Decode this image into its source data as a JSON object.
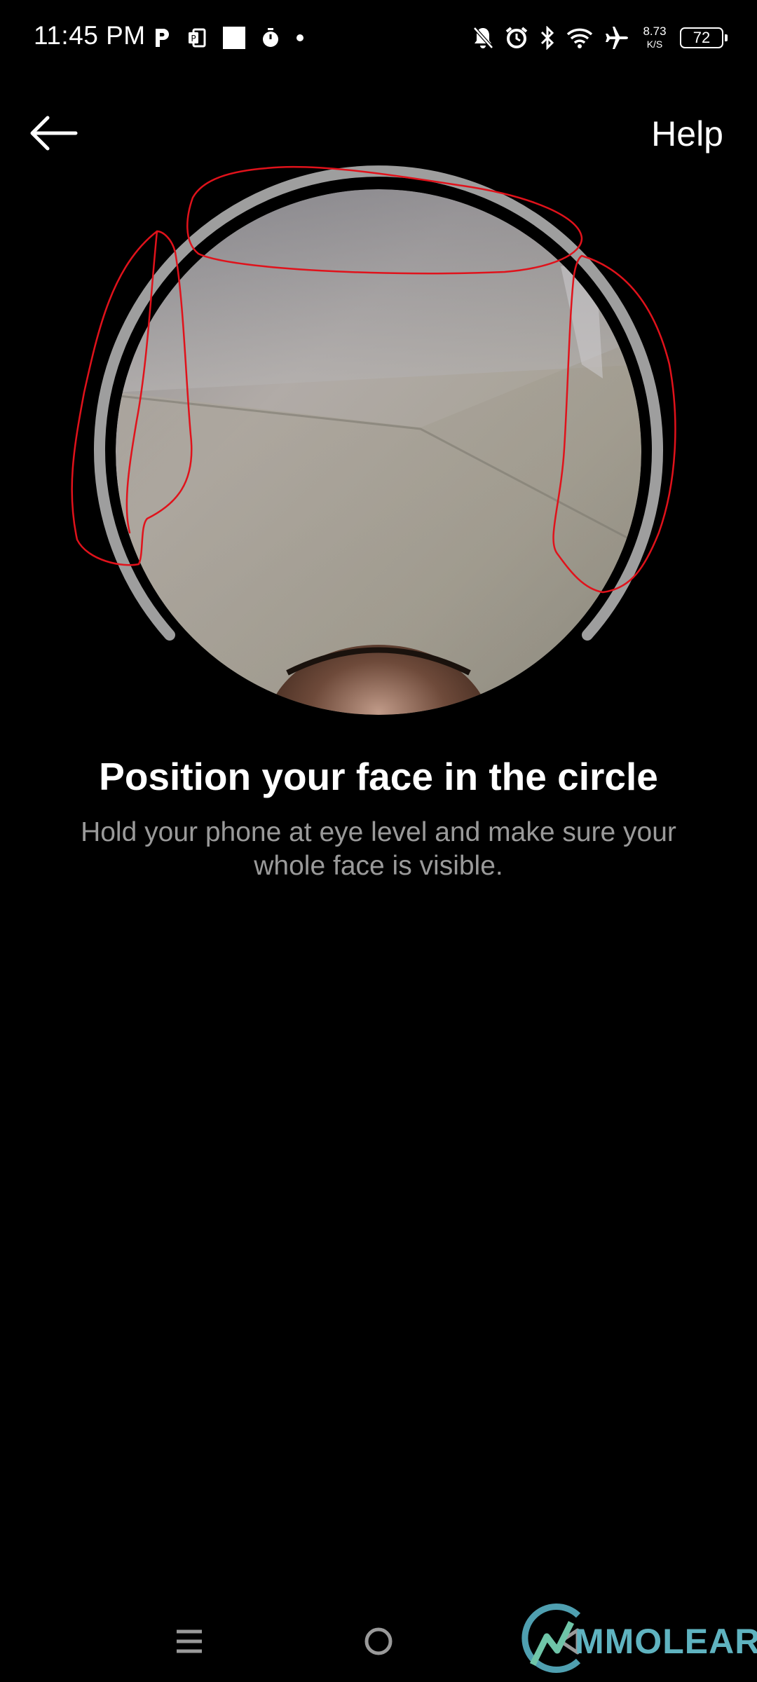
{
  "status_bar": {
    "time": "11:45 PM",
    "left_icons": [
      "parking-app-icon",
      "office-app-icon",
      "white-square-icon",
      "timer-icon",
      "dot-indicator-icon"
    ],
    "right_icons": [
      "bell-muted-icon",
      "alarm-icon",
      "bluetooth-icon",
      "wifi-icon",
      "airplane-icon"
    ],
    "network_speed_value": "8.73",
    "network_speed_unit": "K/S",
    "battery_level": "72"
  },
  "app_bar": {
    "back_icon": "arrow-left-icon",
    "help_label": "Help"
  },
  "camera": {
    "ring_color": "#9e9e9e",
    "annotation_color": "#e0121b"
  },
  "instructions": {
    "title": "Position your face in the circle",
    "body": "Hold your phone at eye level and make sure your whole face is visible."
  },
  "nav_bar": {
    "icons": [
      "menu-lines-icon",
      "home-circle-icon",
      "back-triangle-icon"
    ]
  },
  "watermark": {
    "text": "MMOLEARN"
  }
}
